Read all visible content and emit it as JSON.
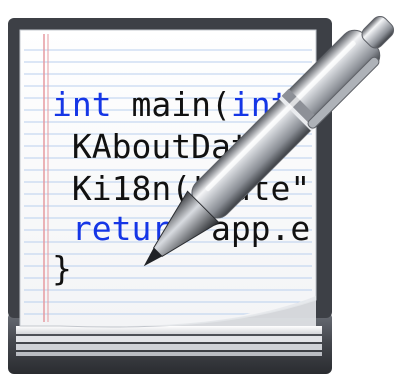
{
  "icon": {
    "name": "kate-text-editor",
    "code_lines": [
      {
        "segments": [
          {
            "text": "int",
            "color": "#1536e6"
          },
          {
            "text": " main(",
            "color": "#111111"
          },
          {
            "text": "int",
            "color": "#1536e6"
          }
        ]
      },
      {
        "segments": [
          {
            "text": " KAboutData",
            "color": "#111111"
          }
        ]
      },
      {
        "segments": [
          {
            "text": " Ki18n(\"Kate\"",
            "color": "#111111"
          }
        ]
      },
      {
        "segments": [
          {
            "text": " return",
            "color": "#1536e6"
          },
          {
            "text": " app.e",
            "color": "#111111"
          }
        ]
      },
      {
        "segments": [
          {
            "text": "}",
            "color": "#111111"
          }
        ]
      }
    ],
    "colors": {
      "keyword": "#1536e6",
      "text": "#111111",
      "paper": "#fbfbfb",
      "paper_lines": "#b9cfee",
      "margin_line": "#e69aa0",
      "book_cover": "#4d5057",
      "pen_body": "#c9ccd1",
      "pen_dark": "#2b2d31"
    }
  }
}
